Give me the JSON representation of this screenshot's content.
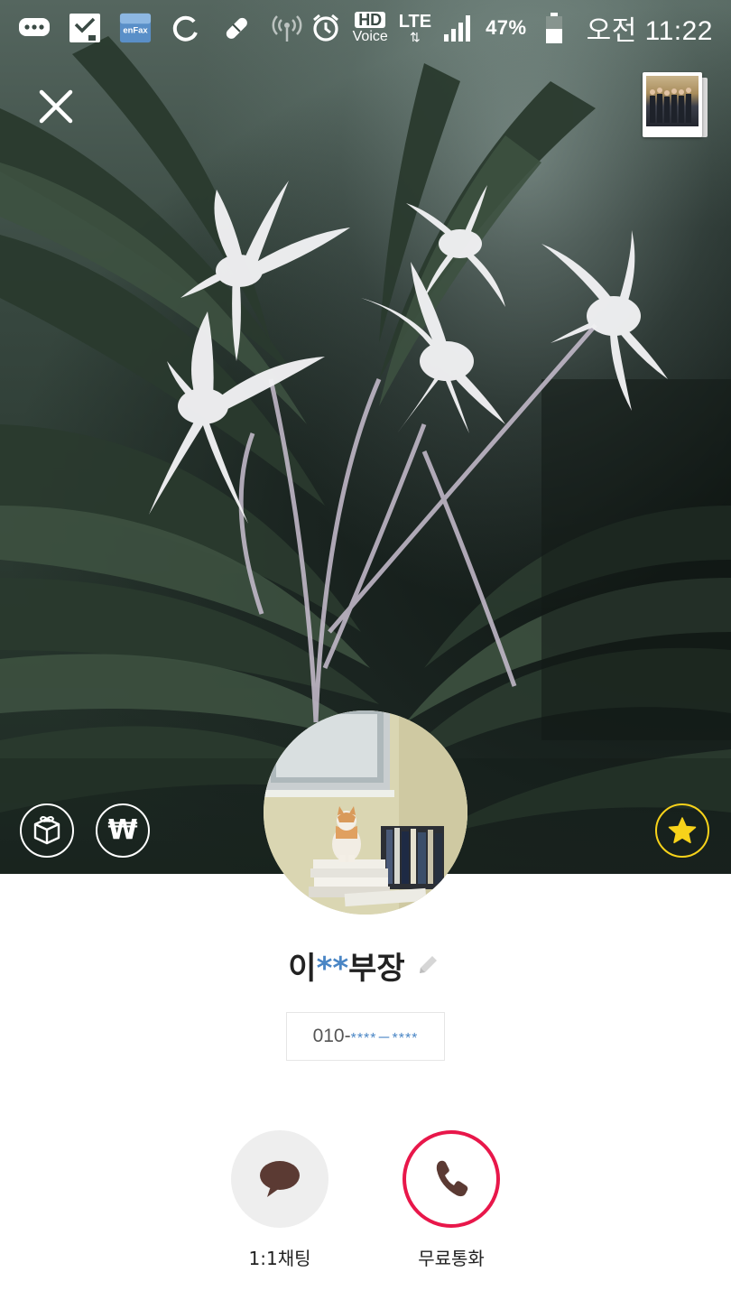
{
  "status_bar": {
    "hd_label": "HD",
    "voice_label": "Voice",
    "network_label": "LTE",
    "battery_percent": "47%",
    "time": "오전 11:22",
    "icons": [
      "messages-icon",
      "checklist-icon",
      "enfax-icon",
      "sync-icon",
      "pill-icon",
      "hotspot-icon",
      "alarm-icon",
      "signal-icon",
      "battery-icon"
    ],
    "enfax_text": "enFax"
  },
  "profile": {
    "name_prefix": "이",
    "name_mask": "**",
    "name_suffix": "부장",
    "phone_prefix": "010-",
    "phone_mask": "****－****"
  },
  "actions": {
    "chat_label": "1:1채팅",
    "call_label": "무료통화"
  },
  "colors": {
    "call_ring": "#e8174a",
    "favorite_ring": "#f7d21a",
    "mask_blue": "#4a86c5",
    "action_icon": "#5b3a33"
  }
}
